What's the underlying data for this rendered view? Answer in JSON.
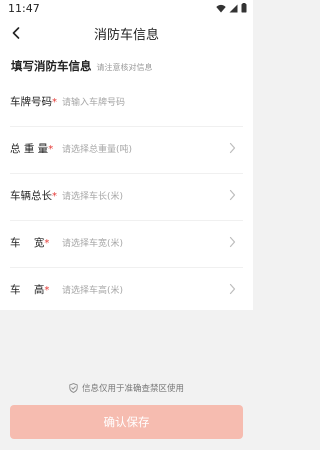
{
  "status_bar": {
    "time": "11:47"
  },
  "header": {
    "title": "消防车信息"
  },
  "section": {
    "title": "填写消防车信息",
    "hint": "请注意核对信息"
  },
  "fields": [
    {
      "label": "车牌号码",
      "placeholder": "请输入车牌号码",
      "required": true
    },
    {
      "label": "总 重 量",
      "placeholder": "请选择总重量(吨)",
      "required": true
    },
    {
      "label": "车辆总长",
      "placeholder": "请选择车长(米)",
      "required": true
    },
    {
      "label": "车    宽",
      "placeholder": "请选择车宽(米)",
      "required": true
    },
    {
      "label": "车    高",
      "placeholder": "请选择车高(米)",
      "required": true
    }
  ],
  "required_mark": "*",
  "notice": {
    "text": "信息仅用于准确查禁区使用"
  },
  "footer": {
    "confirm_label": "确认保存"
  },
  "colors": {
    "accent_disabled": "#f6bcb0",
    "required": "#e53935"
  }
}
